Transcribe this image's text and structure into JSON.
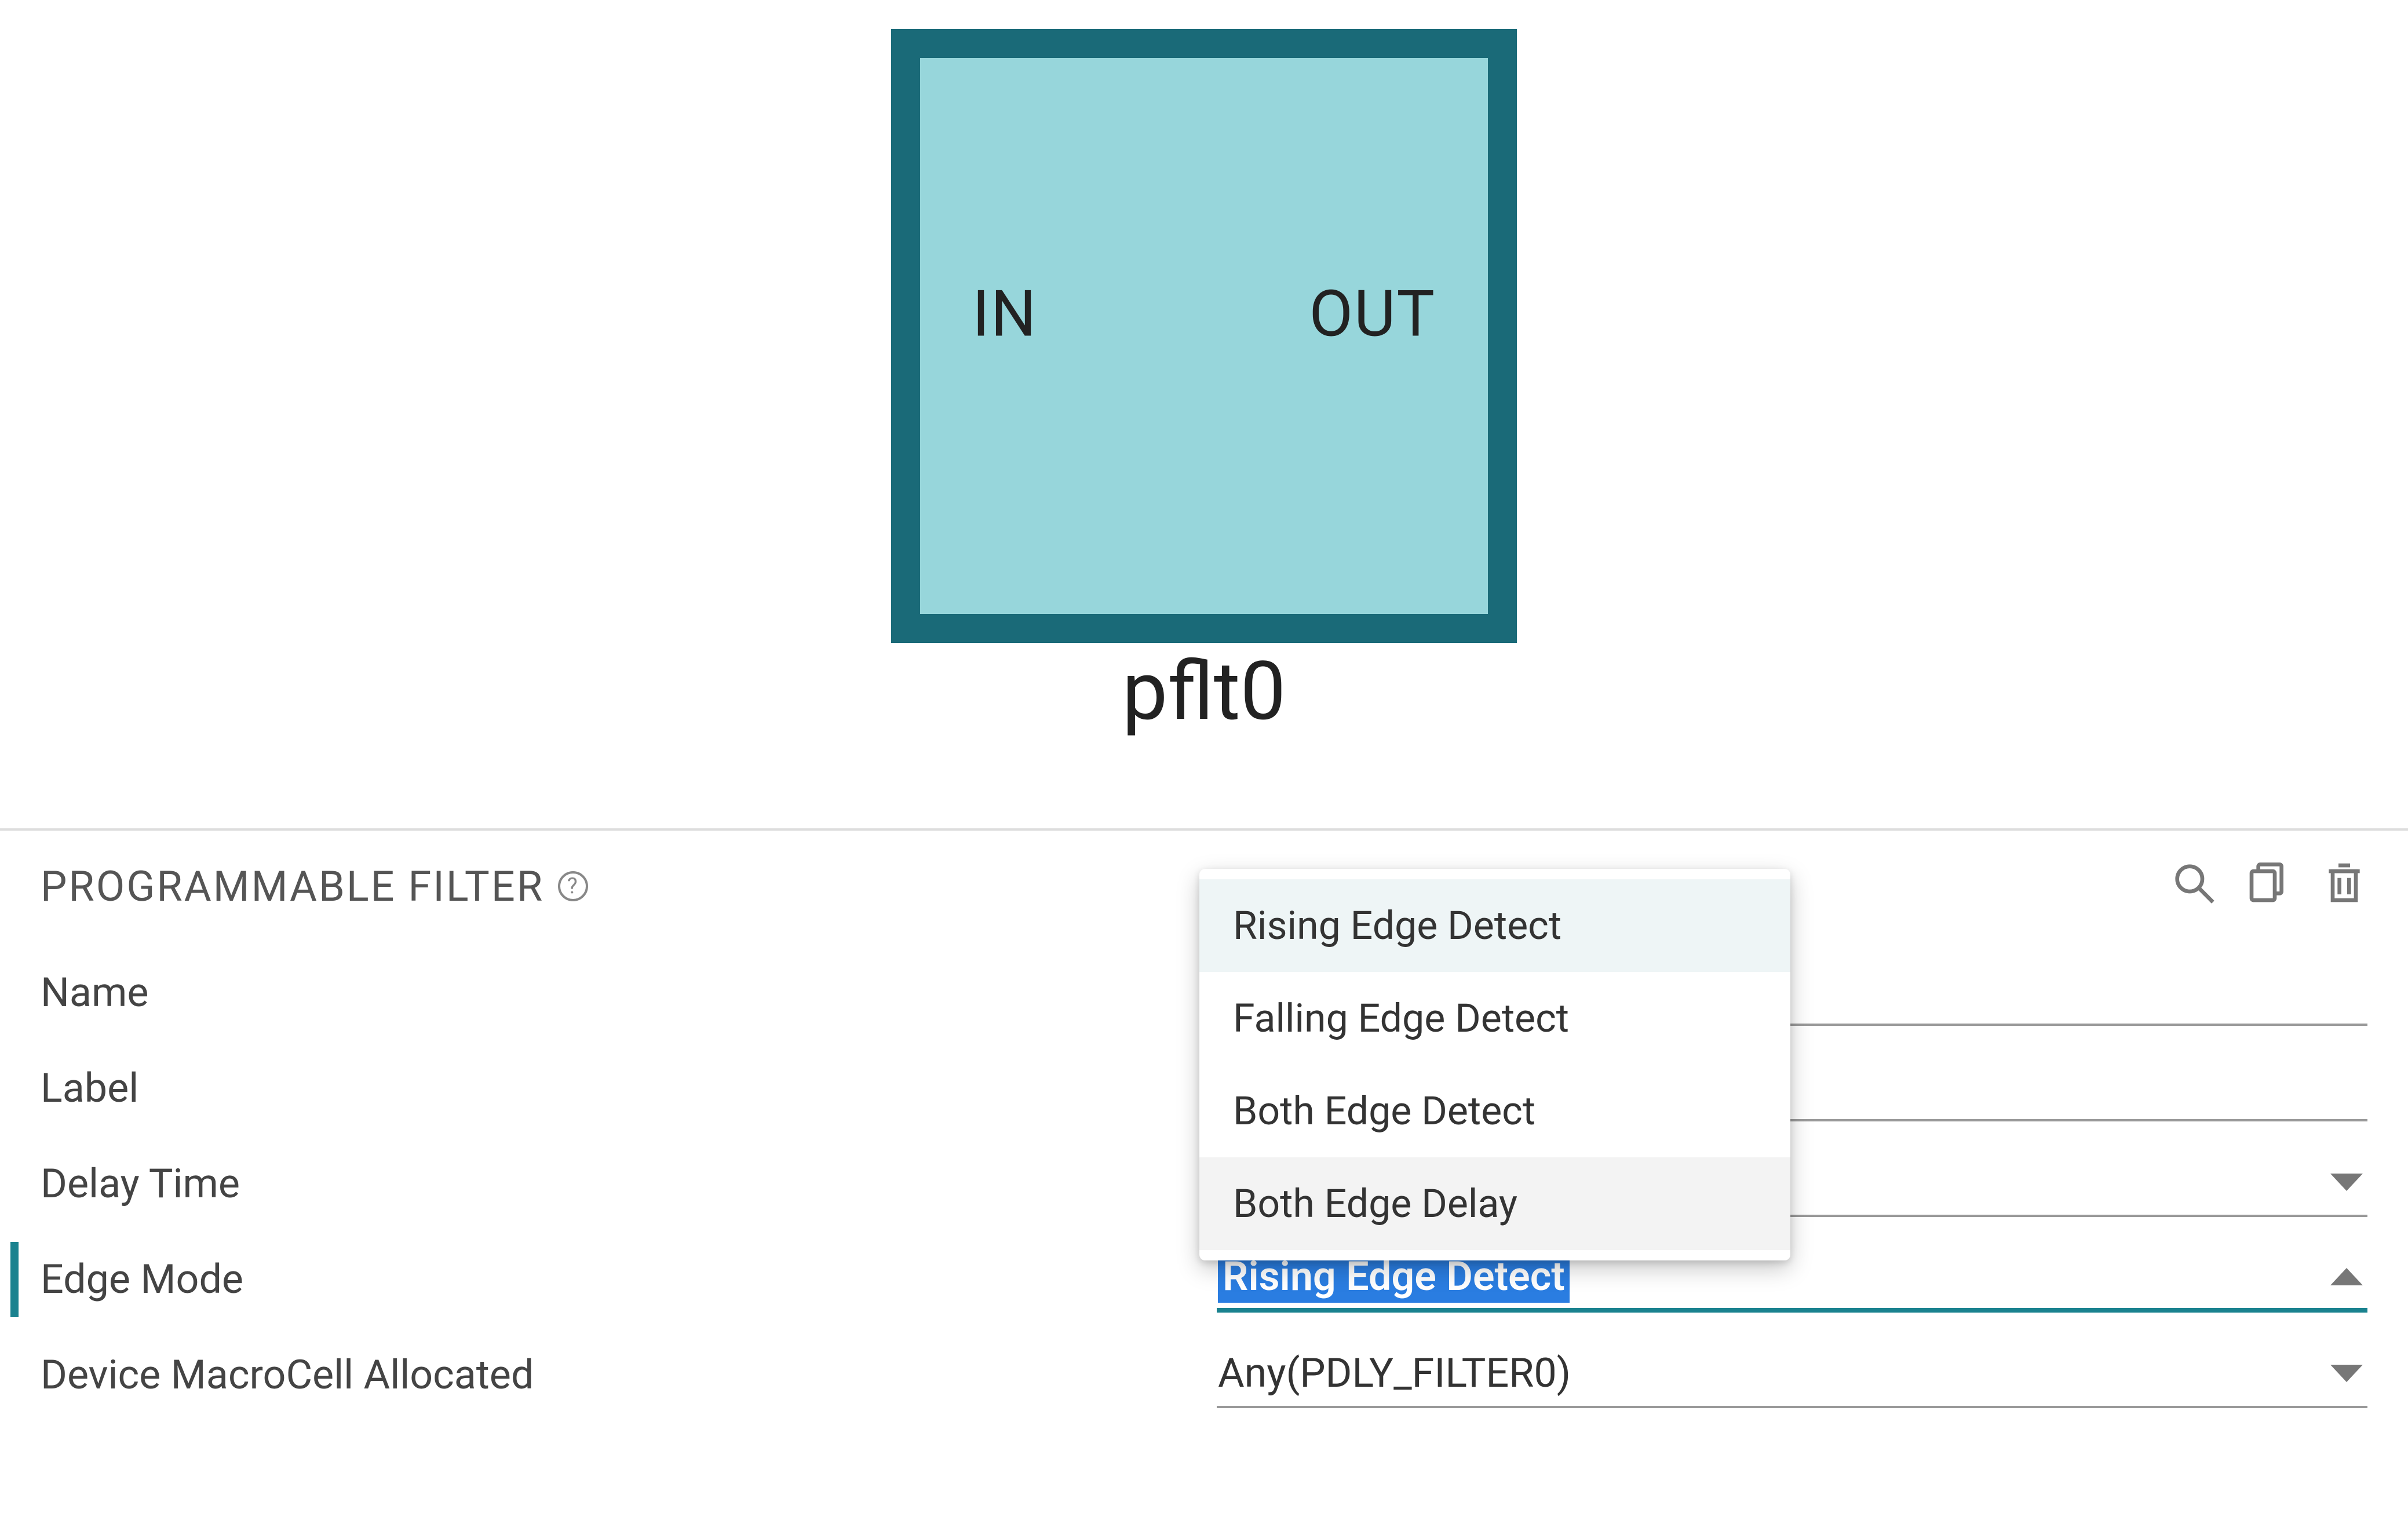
{
  "block": {
    "port_in": "IN",
    "port_out": "OUT",
    "label": "pflt0"
  },
  "panel": {
    "title": "PROGRAMMABLE FILTER",
    "help_glyph": "?",
    "actions": {
      "search": "search-icon",
      "copy": "copy-icon",
      "delete": "trash-icon"
    },
    "rows": {
      "name": {
        "label": "Name",
        "value": ""
      },
      "label": {
        "label": "Label",
        "value": ""
      },
      "delay": {
        "label": "Delay Time",
        "value": ""
      },
      "edge": {
        "label": "Edge Mode",
        "value": "Rising Edge Detect"
      },
      "macro": {
        "label": "Device MacroCell Allocated",
        "value": "Any(PDLY_FILTER0)"
      }
    }
  },
  "dropdown": {
    "options": [
      "Rising Edge Detect",
      "Falling Edge Detect",
      "Both Edge Detect",
      "Both Edge Delay"
    ],
    "highlight_index": 0,
    "hover_index": 3
  },
  "colors": {
    "block_fill": "#97d6db",
    "block_border": "#1a6a78",
    "accent": "#1a828f",
    "select_bg": "#2a7de1"
  }
}
